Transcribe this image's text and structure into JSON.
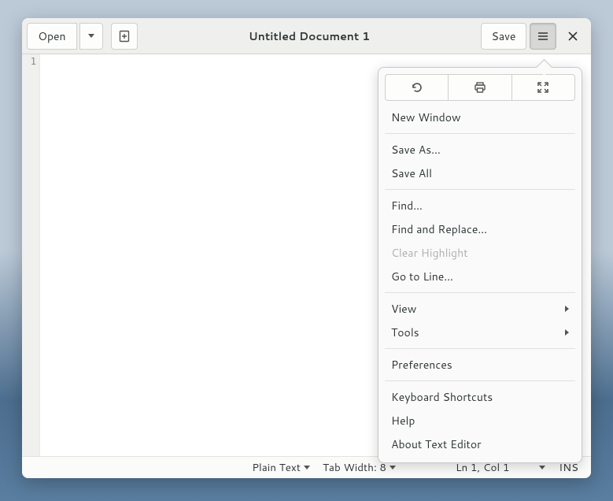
{
  "header": {
    "open_label": "Open",
    "save_label": "Save",
    "title": "Untitled Document 1"
  },
  "gutter": {
    "line1": "1"
  },
  "menu": {
    "new_window": "New Window",
    "save_as": "Save As…",
    "save_all": "Save All",
    "find": "Find…",
    "find_replace": "Find and Replace…",
    "clear_highlight": "Clear Highlight",
    "go_to_line": "Go to Line…",
    "view": "View",
    "tools": "Tools",
    "preferences": "Preferences",
    "keyboard_shortcuts": "Keyboard Shortcuts",
    "help": "Help",
    "about": "About Text Editor"
  },
  "statusbar": {
    "language": "Plain Text",
    "tab_width": "Tab Width: 8",
    "position": "Ln 1, Col 1",
    "insert_mode": "INS"
  }
}
